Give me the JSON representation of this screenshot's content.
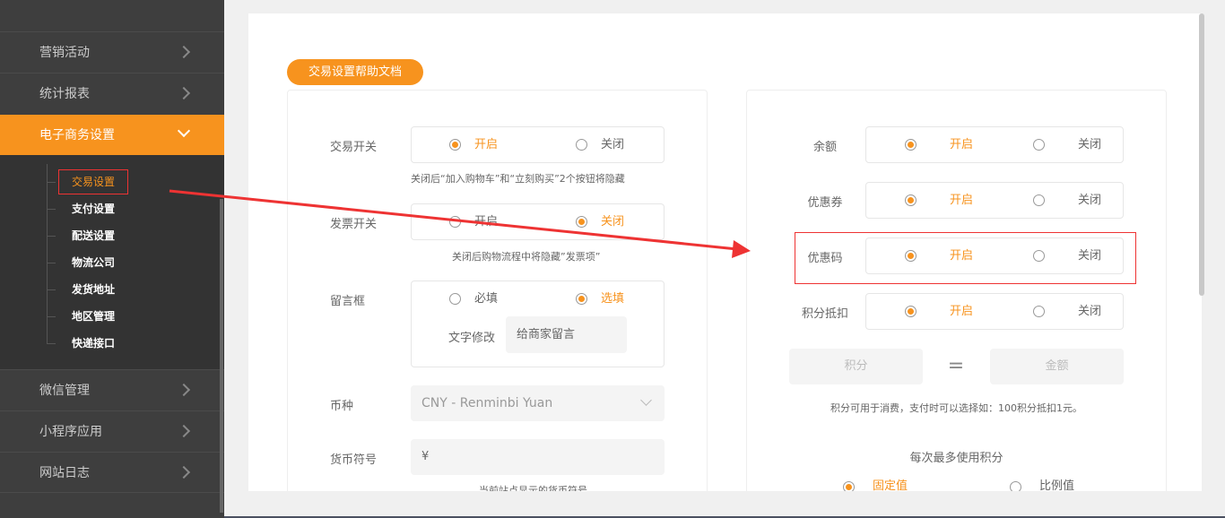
{
  "sidebar": {
    "items": [
      {
        "label": "营销活动"
      },
      {
        "label": "统计报表"
      },
      {
        "label": "电子商务设置"
      },
      {
        "label": "微信管理"
      },
      {
        "label": "小程序应用"
      },
      {
        "label": "网站日志"
      }
    ],
    "subitems": [
      {
        "label": "交易设置"
      },
      {
        "label": "支付设置"
      },
      {
        "label": "配送设置"
      },
      {
        "label": "物流公司"
      },
      {
        "label": "发货地址"
      },
      {
        "label": "地区管理"
      },
      {
        "label": "快递接口"
      }
    ]
  },
  "help_button": "交易设置帮助文档",
  "left": {
    "trade": {
      "label": "交易开关",
      "on": "开启",
      "off": "关闭",
      "selected": "on",
      "hint": "关闭后“加入购物车”和“立刻购买”2个按钮将隐藏"
    },
    "invoice": {
      "label": "发票开关",
      "on": "开启",
      "off": "关闭",
      "selected": "off",
      "hint": "关闭后购物流程中将隐藏”发票项”"
    },
    "message": {
      "label": "留言框",
      "required": "必填",
      "optional": "选填",
      "selected": "optional",
      "text_label": "文字修改",
      "text_value": "给商家留言"
    },
    "currency": {
      "label": "币种",
      "value": "CNY - Renminbi Yuan"
    },
    "symbol": {
      "label": "货币符号",
      "value": "¥",
      "hint": "当前站点显示的货币符号"
    }
  },
  "right": {
    "balance": {
      "label": "余额",
      "on": "开启",
      "off": "关闭",
      "selected": "on"
    },
    "coupon": {
      "label": "优惠券",
      "on": "开启",
      "off": "关闭",
      "selected": "on"
    },
    "promo": {
      "label": "优惠码",
      "on": "开启",
      "off": "关闭",
      "selected": "on"
    },
    "points": {
      "label": "积分抵扣",
      "on": "开启",
      "off": "关闭",
      "selected": "on"
    },
    "points_placeholder": "积分",
    "amount_placeholder": "金额",
    "equals": "=",
    "points_hint": "积分可用于消费，支付时可以选择如：100积分抵扣1元。",
    "max_title": "每次最多使用积分",
    "fixed": "固定值",
    "ratio": "比例值",
    "max_selected": "fixed"
  },
  "colors": {
    "accent": "#f7931e",
    "sidebar": "#3e3e3e",
    "annotation": "#e33333"
  }
}
